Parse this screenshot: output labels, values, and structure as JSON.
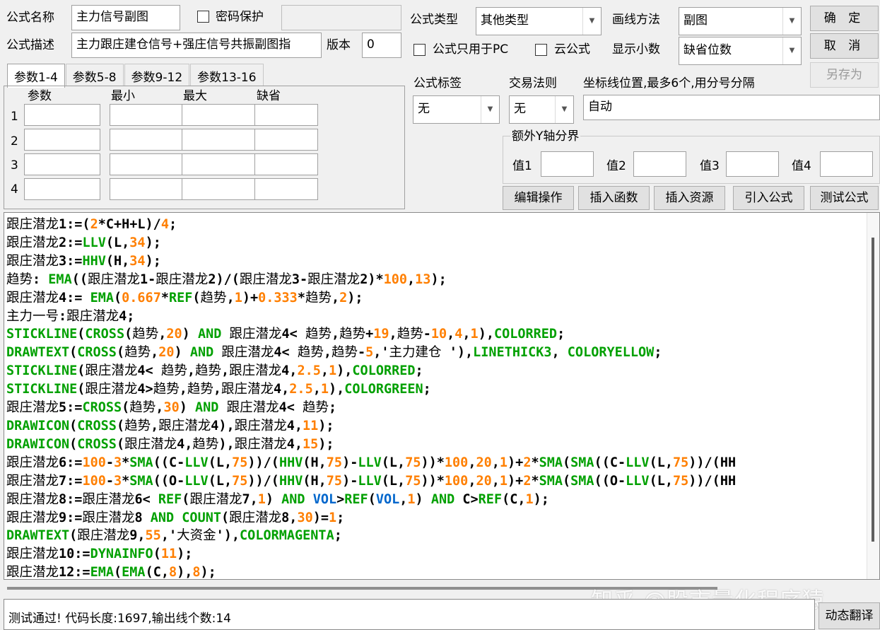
{
  "formula": {
    "name_label": "公式名称",
    "name_value": "主力信号副图",
    "password_label": "密码保护",
    "desc_label": "公式描述",
    "desc_value": "主力跟庄建仓信号+强庄信号共振副图指",
    "version_label": "版本",
    "version_value": "0",
    "type_label": "公式类型",
    "type_value": "其他类型",
    "draw_label": "画线方法",
    "draw_value": "副图",
    "pc_only_label": "公式只用于PC",
    "cloud_label": "云公式",
    "decimals_label": "显示小数",
    "decimals_value": "缺省位数"
  },
  "buttons": {
    "ok": "确 定",
    "cancel": "取 消",
    "save_as": "另存为",
    "edit": "编辑操作",
    "insert_func": "插入函数",
    "insert_res": "插入资源",
    "import": "引入公式",
    "test": "测试公式",
    "translate": "动态翻译"
  },
  "tabs": [
    "参数1-4",
    "参数5-8",
    "参数9-12",
    "参数13-16"
  ],
  "params": {
    "headers": [
      "参数",
      "最小",
      "最大",
      "缺省"
    ],
    "rows": [
      "1",
      "2",
      "3",
      "4"
    ]
  },
  "tag": {
    "label": "公式标签",
    "value": "无"
  },
  "trade": {
    "label": "交易法则",
    "value": "无"
  },
  "axis": {
    "label": "坐标线位置,最多6个,用分号分隔",
    "value": "自动"
  },
  "yaxis": {
    "group_label": "额外Y轴分界",
    "v1": "值1",
    "v2": "值2",
    "v3": "值3",
    "v4": "值4"
  },
  "code_lines": [
    "跟庄潜龙1:=(2*C+H+L)/4;",
    "跟庄潜龙2:=LLV(L,34);",
    "跟庄潜龙3:=HHV(H,34);",
    "趋势: EMA((跟庄潜龙1-跟庄潜龙2)/(跟庄潜龙3-跟庄潜龙2)*100,13);",
    "跟庄潜龙4:= EMA(0.667*REF(趋势,1)+0.333*趋势,2);",
    "主力一号:跟庄潜龙4;",
    "STICKLINE(CROSS(趋势,20) AND 跟庄潜龙4< 趋势,趋势+19,趋势-10,4,1),COLORRED;",
    "DRAWTEXT(CROSS(趋势,20) AND 跟庄潜龙4< 趋势,趋势-5,'主力建仓 '),LINETHICK3, COLORYELLOW;",
    "STICKLINE(跟庄潜龙4< 趋势,趋势,跟庄潜龙4,2.5,1),COLORRED;",
    "STICKLINE(跟庄潜龙4>趋势,趋势,跟庄潜龙4,2.5,1),COLORGREEN;",
    "跟庄潜龙5:=CROSS(趋势,30) AND 跟庄潜龙4< 趋势;",
    "DRAWICON(CROSS(趋势,跟庄潜龙4),跟庄潜龙4,11);",
    "DRAWICON(CROSS(跟庄潜龙4,趋势),跟庄潜龙4,15);",
    "跟庄潜龙6:=100-3*SMA((C-LLV(L,75))/(HHV(H,75)-LLV(L,75))*100,20,1)+2*SMA(SMA((C-LLV(L,75))/(HH",
    "跟庄潜龙7:=100-3*SMA((O-LLV(L,75))/(HHV(H,75)-LLV(L,75))*100,20,1)+2*SMA(SMA((O-LLV(L,75))/(HH",
    "跟庄潜龙8:=跟庄潜龙6< REF(跟庄潜龙7,1) AND VOL>REF(VOL,1) AND C>REF(C,1);",
    "跟庄潜龙9:=跟庄潜龙8 AND COUNT(跟庄潜龙8,30)=1;",
    "DRAWTEXT(跟庄潜龙9,55,'大资金'),COLORMAGENTA;",
    "跟庄潜龙10:=DYNAINFO(11);",
    "跟庄潜龙12:=EMA(EMA(C,8),8);"
  ],
  "status": "测试通过! 代码长度:1697,输出线个数:14",
  "watermark": "知乎 @股市量化程序猿",
  "colors": {
    "function": "#00a000",
    "number": "#ff7f00",
    "keyword_vol": "#0066cc"
  }
}
